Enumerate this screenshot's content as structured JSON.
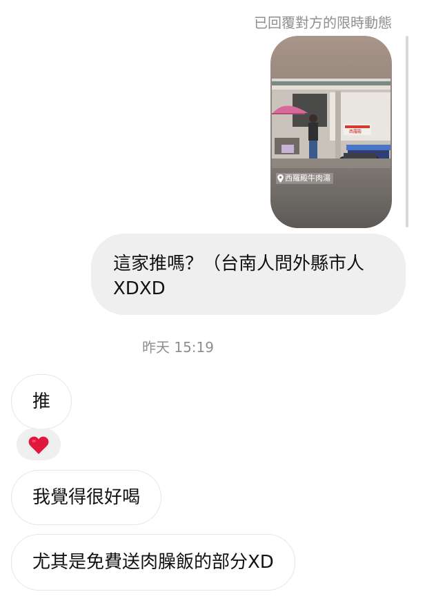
{
  "thread": {
    "story_reply_label": "已回覆對方的限時動態",
    "story": {
      "location": "西羅殿牛肉湯",
      "shop_sign": "西羅殿"
    },
    "messages": [
      {
        "sender": "me",
        "text": "這家推嗎？（台南人問外縣市人 XDXD"
      },
      {
        "sender": "them",
        "text": "推"
      },
      {
        "sender": "them",
        "text": "我覺得很好喝"
      },
      {
        "sender": "them",
        "text": "尤其是免費送肉臊飯的部分XD"
      }
    ],
    "timestamp": "昨天 15:19",
    "reaction": {
      "icon": "heart-icon",
      "color": "#e0183b"
    }
  }
}
